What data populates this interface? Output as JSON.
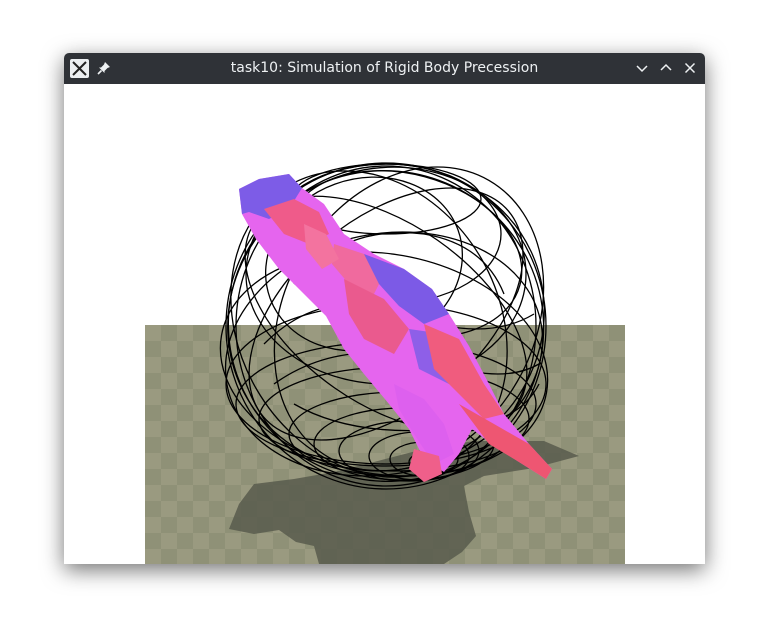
{
  "window": {
    "title": "task10: Simulation of Rigid Body Precession",
    "icons": [
      "app-icon",
      "pin-icon",
      "minimize-icon",
      "maximize-icon",
      "close-icon"
    ]
  },
  "scene": {
    "floor_colors": [
      "#9a9a80",
      "#8f9177"
    ],
    "body_colors": [
      "#e060f0",
      "#ee5a86",
      "#7c5ae6"
    ],
    "trace_color": "#000000",
    "shadow_color": "#585a4c"
  }
}
